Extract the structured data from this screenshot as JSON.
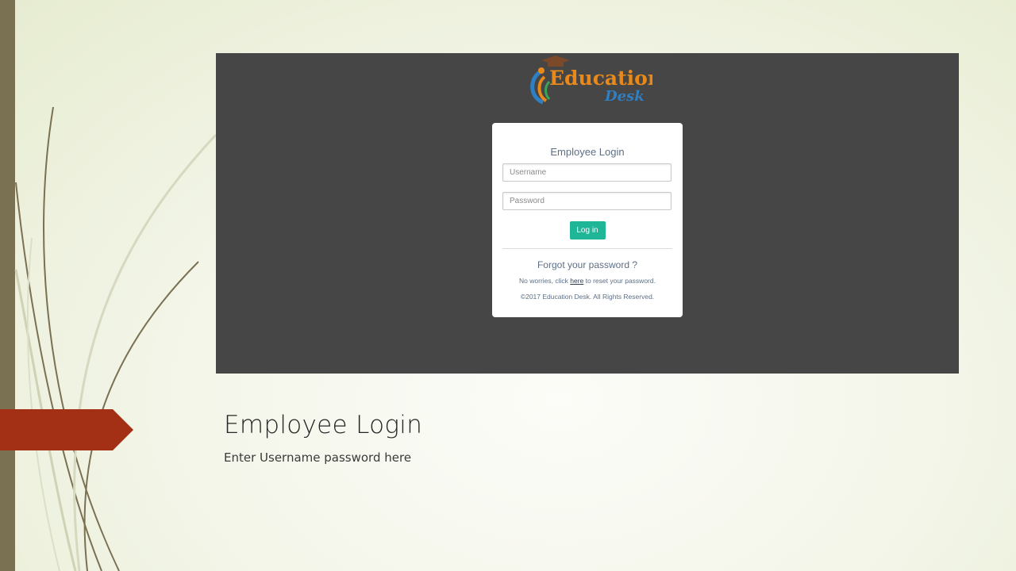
{
  "logo": {
    "line1": "Education",
    "line2": "Desk",
    "icon": "graduation-cap-icon"
  },
  "login_form": {
    "title": "Employee Login",
    "username_placeholder": "Username",
    "password_placeholder": "Password",
    "login_button": "Log in",
    "forgot_title": "Forgot your password ?",
    "reset_prefix": "No worries, click ",
    "reset_link": "here",
    "reset_suffix": " to reset your password.",
    "copyright": "©2017 Education Desk. All Rights Reserved."
  },
  "slide": {
    "title": "Employee Login",
    "subtitle": "Enter Username password here"
  },
  "colors": {
    "accent_green": "#1fb597",
    "logo_orange": "#e8891a",
    "logo_blue": "#2f7fc4",
    "arrow_red": "#a33015",
    "side_bar": "#7a7052"
  }
}
